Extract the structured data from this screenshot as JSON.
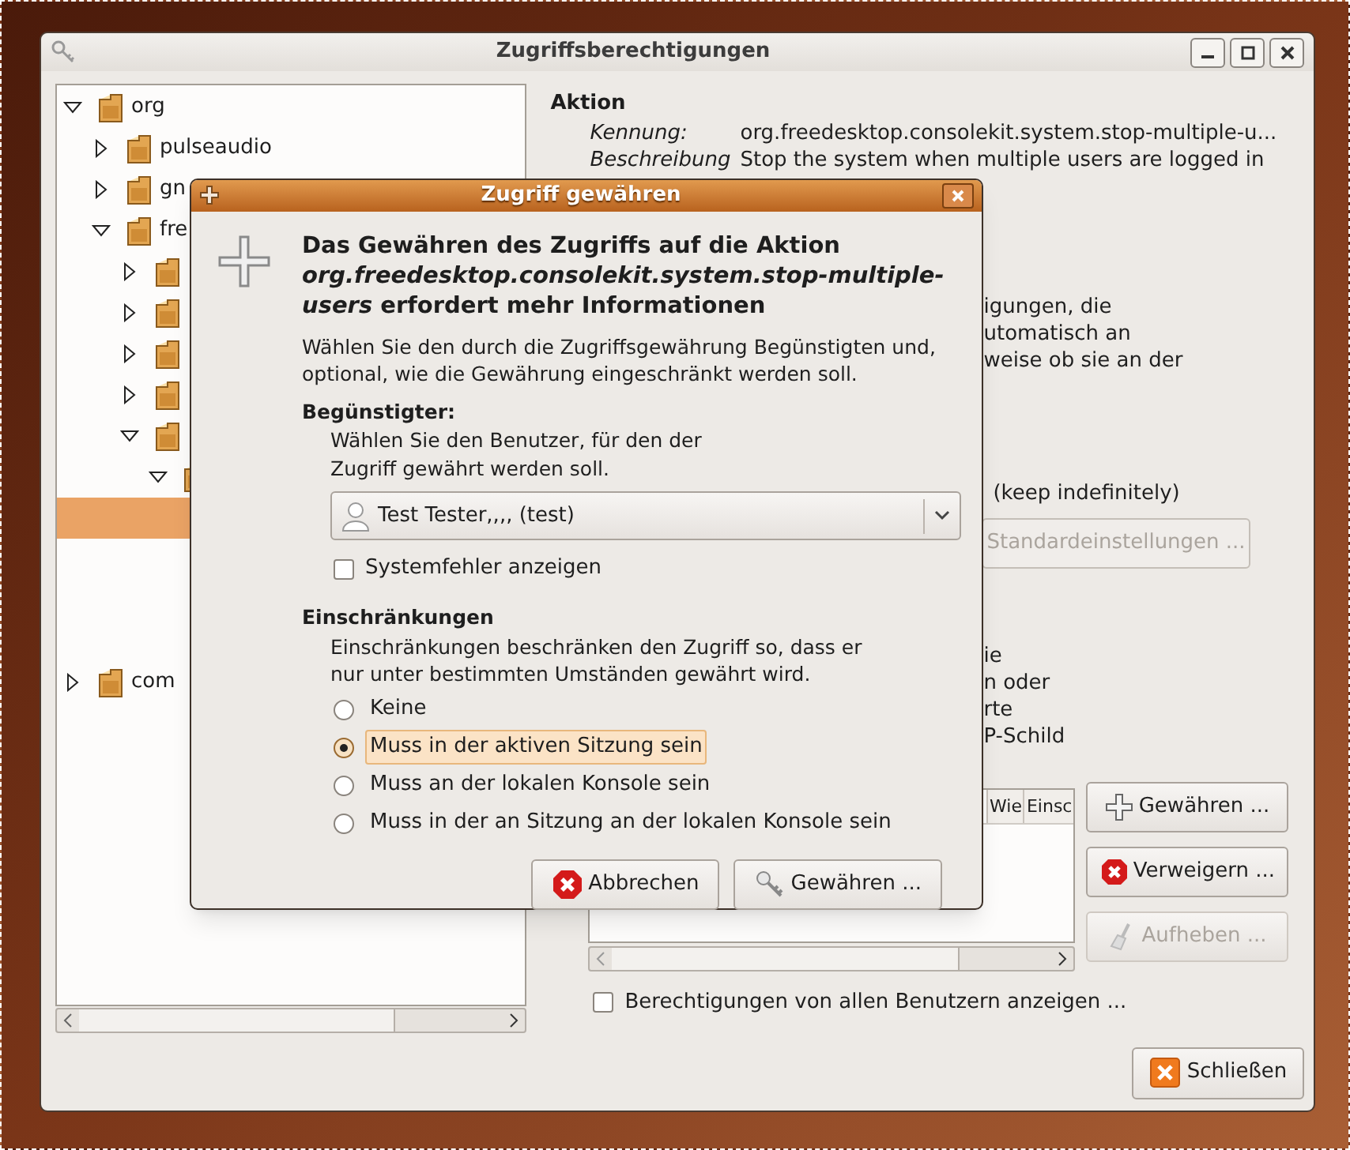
{
  "window": {
    "title": "Zugriffsberechtigungen"
  },
  "tree": [
    {
      "label": "org",
      "expanded": true,
      "selected": false,
      "children": [
        {
          "label": "pulseaudio",
          "expanded": false,
          "selected": false
        },
        {
          "label": "gn",
          "expanded": false,
          "selected": false
        },
        {
          "label": "fre",
          "expanded": true,
          "selected": false,
          "children": [
            {
              "expanded": false,
              "selected": false
            },
            {
              "expanded": false,
              "selected": false
            },
            {
              "expanded": false,
              "selected": false
            },
            {
              "expanded": false,
              "selected": false
            },
            {
              "expanded": true,
              "selected": false,
              "children": [
                {
                  "expanded": true,
                  "selected": false,
                  "children": [
                    {
                      "selected": true
                    }
                  ]
                }
              ]
            }
          ]
        }
      ]
    },
    {
      "label": "com",
      "expanded": false,
      "selected": false
    }
  ],
  "action": {
    "title": "Aktion",
    "fields": [
      {
        "label": "Kennung:",
        "value": "org.freedesktop.consolekit.system.stop-multiple-u..."
      },
      {
        "label": "Beschreibung",
        "value": "Stop the system when multiple users are logged in"
      }
    ]
  },
  "fragments_1": [
    "igungen, die",
    "utomatisch an",
    "weise ob sie an der"
  ],
  "keep_text": "(keep indefinitely)",
  "defaults_button": {
    "label": "Standardeinstellungen ...",
    "disabled": true
  },
  "fragments_2": [
    "ie",
    "n oder",
    "rte",
    "P-Schild"
  ],
  "table": {
    "columns": [
      "Wie",
      "Einsc"
    ]
  },
  "side_buttons": [
    {
      "label": "Gewähren ...",
      "kind": "grant",
      "disabled": false
    },
    {
      "label": "Verweigern ...",
      "kind": "deny",
      "disabled": false
    },
    {
      "label": "Aufheben ...",
      "kind": "revoke",
      "disabled": true
    }
  ],
  "show_all": {
    "label": "Berechtigungen von allen Benutzern anzeigen ...",
    "checked": false
  },
  "close_button": "Schließen",
  "dialog": {
    "title": "Zugriff gewähren",
    "heading": "Das Gewähren des Zugriffs auf die Aktion *org.freedesktop.consolekit.system.stop-multiple-users* erfordert mehr Informationen",
    "description": "Wählen Sie den durch die Zugriffsgewährung Begünstigten und, optional, wie die Gewährung eingeschränkt werden soll.",
    "beneficiary": {
      "title": "Begünstigter:",
      "text": "Wählen Sie den Benutzer, für den der Zugriff gewährt werden soll.",
      "user": "Test Tester,,,, (test)"
    },
    "system_errors": {
      "label": "Systemfehler anzeigen",
      "checked": false
    },
    "restrictions": {
      "title": "Einschränkungen",
      "text": "Einschränkungen beschränken den Zugriff so, dass er nur unter bestimmten Umständen gewährt wird.",
      "options": [
        {
          "label": "Keine",
          "selected": false
        },
        {
          "label": "Muss in der aktiven Sitzung sein",
          "selected": true
        },
        {
          "label": "Muss an der lokalen Konsole sein",
          "selected": false
        },
        {
          "label": "Muss in der an Sitzung an der lokalen Konsole sein",
          "selected": false
        }
      ]
    },
    "buttons": [
      {
        "label": "Abbrechen",
        "kind": "cancel"
      },
      {
        "label": "Gewähren ...",
        "kind": "grant"
      }
    ]
  }
}
